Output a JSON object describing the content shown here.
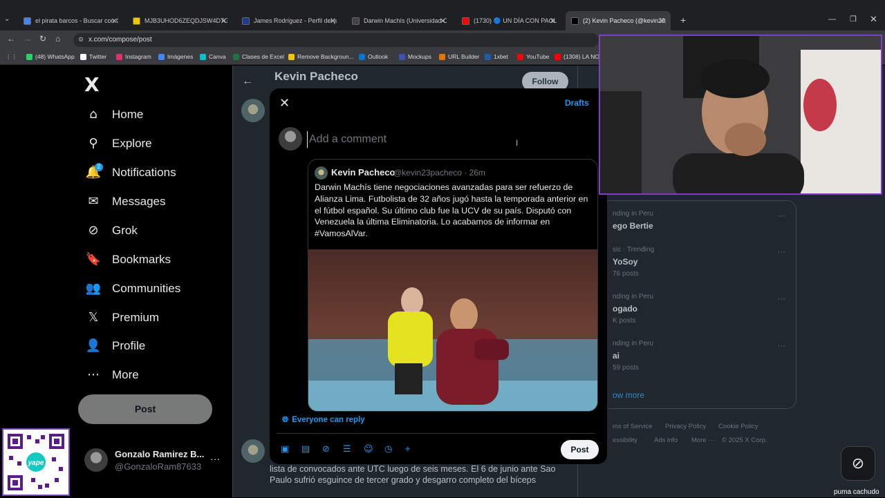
{
  "browser": {
    "tabs": [
      {
        "title": "el pirata barcos - Buscar con Go",
        "color": "#4285f4"
      },
      {
        "title": "MJB3UHOD6ZEQDJSW4D7GKA",
        "color": "#f5c400"
      },
      {
        "title": "James Rodríguez - Perfil del juga",
        "color": "#1c3d8f"
      },
      {
        "title": "Darwin Machís (Universidad Cen",
        "color": "#444444"
      },
      {
        "title": "(1730) 🔵 UN DÍA CON PAOLO",
        "color": "#ff0000"
      },
      {
        "title": "(2) Kevin Pacheco (@kevin23pa",
        "color": "#000000"
      }
    ],
    "url": "x.com/compose/post",
    "bookmarks": [
      {
        "label": "(48) WhatsApp",
        "color": "#25d366"
      },
      {
        "label": "Twitter",
        "color": "#ffffff"
      },
      {
        "label": "Instagram",
        "color": "#e1306c"
      },
      {
        "label": "Imágenes",
        "color": "#4285f4"
      },
      {
        "label": "Canva",
        "color": "#00c4cc"
      },
      {
        "label": "Clases de Excel",
        "color": "#217346"
      },
      {
        "label": "Remove Backgroun...",
        "color": "#f5c400"
      },
      {
        "label": "Outlook",
        "color": "#0078d4"
      },
      {
        "label": "Mockups",
        "color": "#3f51b5"
      },
      {
        "label": "URL Builder",
        "color": "#e37400"
      },
      {
        "label": "1xbet",
        "color": "#1a5fa8"
      },
      {
        "label": "YouTube",
        "color": "#ff0000"
      },
      {
        "label": "(1308) LA NO",
        "color": "#ff0000"
      }
    ]
  },
  "sidebar": {
    "logo": "X",
    "notifications_badge": "2",
    "items": [
      {
        "label": "Home",
        "icon": "home-icon",
        "glyph": "⌂"
      },
      {
        "label": "Explore",
        "icon": "search-icon",
        "glyph": "⚲"
      },
      {
        "label": "Notifications",
        "icon": "bell-icon",
        "glyph": "🔔"
      },
      {
        "label": "Messages",
        "icon": "mail-icon",
        "glyph": "✉"
      },
      {
        "label": "Grok",
        "icon": "grok-icon",
        "glyph": "⊘"
      },
      {
        "label": "Bookmarks",
        "icon": "bookmark-icon",
        "glyph": "🔖"
      },
      {
        "label": "Communities",
        "icon": "people-icon",
        "glyph": "👥"
      },
      {
        "label": "Premium",
        "icon": "x-premium-icon",
        "glyph": "𝕏"
      },
      {
        "label": "Profile",
        "icon": "person-icon",
        "glyph": "👤"
      },
      {
        "label": "More",
        "icon": "more-circle-icon",
        "glyph": "⋯"
      }
    ],
    "post_label": "Post",
    "account": {
      "name": "Gonzalo Ramirez B...",
      "handle": "@GonzaloRam87633"
    }
  },
  "main": {
    "title": "Kevin Pacheco",
    "follow_label": "Follow",
    "background_text": "lista de convocados ante UTC luego de seis meses. El 6 de junio ante Sao Paulo sufrió esguince de tercer grado y desgarro completo del bíceps"
  },
  "modal": {
    "drafts_label": "Drafts",
    "input_placeholder": "Add a comment",
    "quote": {
      "name": "Kevin Pacheco",
      "handle_time": "@kevin23pacheco · 26m",
      "text": "Darwin Machís tiene negociaciones avanzadas para ser refuerzo de Alianza Lima. Futbolista de 32 años jugó hasta la temporada anterior en el fútbol español. Su último club fue la UCV de su país. Disputó con Venezuela la última Eliminatoria. Lo acabamos de informar en #VamosAlVar."
    },
    "reply_setting": "Everyone can reply",
    "post_label": "Post",
    "accent": "#1d9bf0"
  },
  "trends": [
    {
      "meta": "nding in Peru",
      "name": "ego Bertie",
      "count": ""
    },
    {
      "meta": "sic · Trending",
      "name": "YoSoy",
      "count": "76 posts"
    },
    {
      "meta": "nding in Peru",
      "name": "ogado",
      "count": "K posts"
    },
    {
      "meta": "nding in Peru",
      "name": "ai",
      "count": "59 posts"
    }
  ],
  "show_more": "ow more",
  "footer": {
    "row1": [
      "ms of Service",
      "Privacy Policy",
      "Cookie Policy"
    ],
    "row2": [
      "essibility",
      "Ads info",
      "More ···",
      "© 2025 X Corp."
    ]
  },
  "stream_overlay": {
    "caption": "puma cachudo",
    "qr_label": "yape"
  }
}
